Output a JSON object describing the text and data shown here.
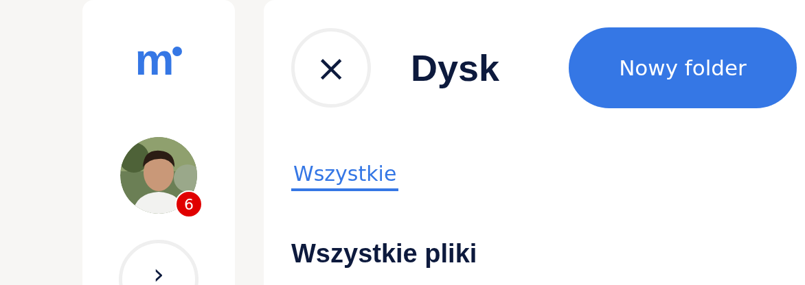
{
  "sidebar": {
    "logo": "m",
    "avatar": {
      "badge": "6"
    },
    "expand_button": "›"
  },
  "header": {
    "close_button": "×",
    "title": "Dysk",
    "new_folder_button": "Nowy folder"
  },
  "tabs": [
    {
      "label": "Wszystkie",
      "selected": true
    }
  ],
  "section_title": "Wszystkie pliki"
}
